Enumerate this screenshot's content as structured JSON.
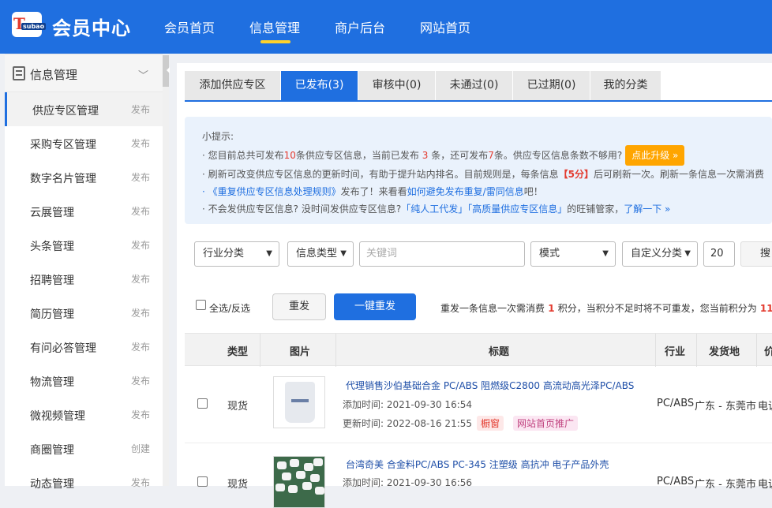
{
  "header": {
    "logo_text": "T",
    "logo_sub": "subao",
    "brand": "会员中心",
    "nav": [
      "会员首页",
      "信息管理",
      "商户后台",
      "网站首页"
    ]
  },
  "sidebar": {
    "title": "信息管理",
    "items": [
      {
        "label": "供应专区管理",
        "action": "发布"
      },
      {
        "label": "采购专区管理",
        "action": "发布"
      },
      {
        "label": "数字名片管理",
        "action": "发布"
      },
      {
        "label": "云展管理",
        "action": "发布"
      },
      {
        "label": "头条管理",
        "action": "发布"
      },
      {
        "label": "招聘管理",
        "action": "发布"
      },
      {
        "label": "简历管理",
        "action": "发布"
      },
      {
        "label": "有问必答管理",
        "action": "发布"
      },
      {
        "label": "物流管理",
        "action": "发布"
      },
      {
        "label": "微视频管理",
        "action": "发布"
      },
      {
        "label": "商圈管理",
        "action": "创建"
      },
      {
        "label": "动态管理",
        "action": "发布"
      }
    ]
  },
  "tabs": [
    "添加供应专区",
    "已发布(3)",
    "审核中(0)",
    "未通过(0)",
    "已过期(0)",
    "我的分类"
  ],
  "tip": {
    "title": "小提示:",
    "l1_a": "· 您目前总共可发布",
    "l1_b": "10",
    "l1_c": "条供应专区信息，当前已发布",
    "l1_d": " 3 ",
    "l1_e": "条，还可发布",
    "l1_f": "7",
    "l1_g": "条。供应专区信息条数不够用?",
    "upgrade": "点此升级 »",
    "l2_a": "· 刷新可改变供应专区信息的更新时间，有助于提升站内排名。目前规则是，每条信息",
    "l2_b": "【5分】",
    "l2_c": "后可刷新一次。刷新一条信息一次需消费",
    "l3_a": "· 《重复供应专区信息处理规则》",
    "l3_b": "发布了！来看看",
    "l3_c": "如何避免发布重复/雷同信息",
    "l3_d": "吧！",
    "l4_a": "· 不会发供应专区信息? 没时间发供应专区信息?",
    "l4_b": "「纯人工代发」「高质量供应专区信息」",
    "l4_c": "的旺铺管家，",
    "l4_d": "了解一下 »"
  },
  "filters": {
    "industry": "行业分类",
    "info_type": "信息类型",
    "keyword_placeholder": "关键词",
    "mode": "模式",
    "custom": "自定义分类",
    "page_size": "20",
    "search": "搜"
  },
  "actions": {
    "select_all": "全选/反选",
    "repost": "重发",
    "one_click_repost": "一键重发",
    "note_a": "重发一条信息一次需消费",
    "note_b": " 1 ",
    "note_c": "积分，当积分不足时将不可重发，您当前积分为",
    "note_d": " 11"
  },
  "table": {
    "headers": [
      "类型",
      "图片",
      "标题",
      "行业",
      "发货地",
      "价"
    ],
    "rows": [
      {
        "type": "现货",
        "title": "代理销售沙伯基础合金 PC/ABS 阻燃级C2800 高流动高光泽PC/ABS",
        "add_label": "添加时间:",
        "add_time": "2021-09-30 16:54",
        "update_label": "更新时间:",
        "update_time": "2022-08-16 21:55",
        "badge1": "橱窗",
        "badge2": "网站首页推广",
        "industry": "PC/ABS",
        "origin": "广东 - 东莞市",
        "price": "电议"
      },
      {
        "type": "现货",
        "title": "台湾奇美 合金料PC/ABS PC-345 注塑级 高抗冲 电子产品外壳",
        "add_label": "添加时间:",
        "add_time": "2021-09-30 16:56",
        "industry": "PC/ABS",
        "origin": "广东 - 东莞市",
        "price": "电议"
      }
    ]
  },
  "colors": {
    "primary": "#1f6fe0",
    "accent": "#ffd22a",
    "warn": "#e33b2f",
    "upgrade": "#ffa500"
  }
}
